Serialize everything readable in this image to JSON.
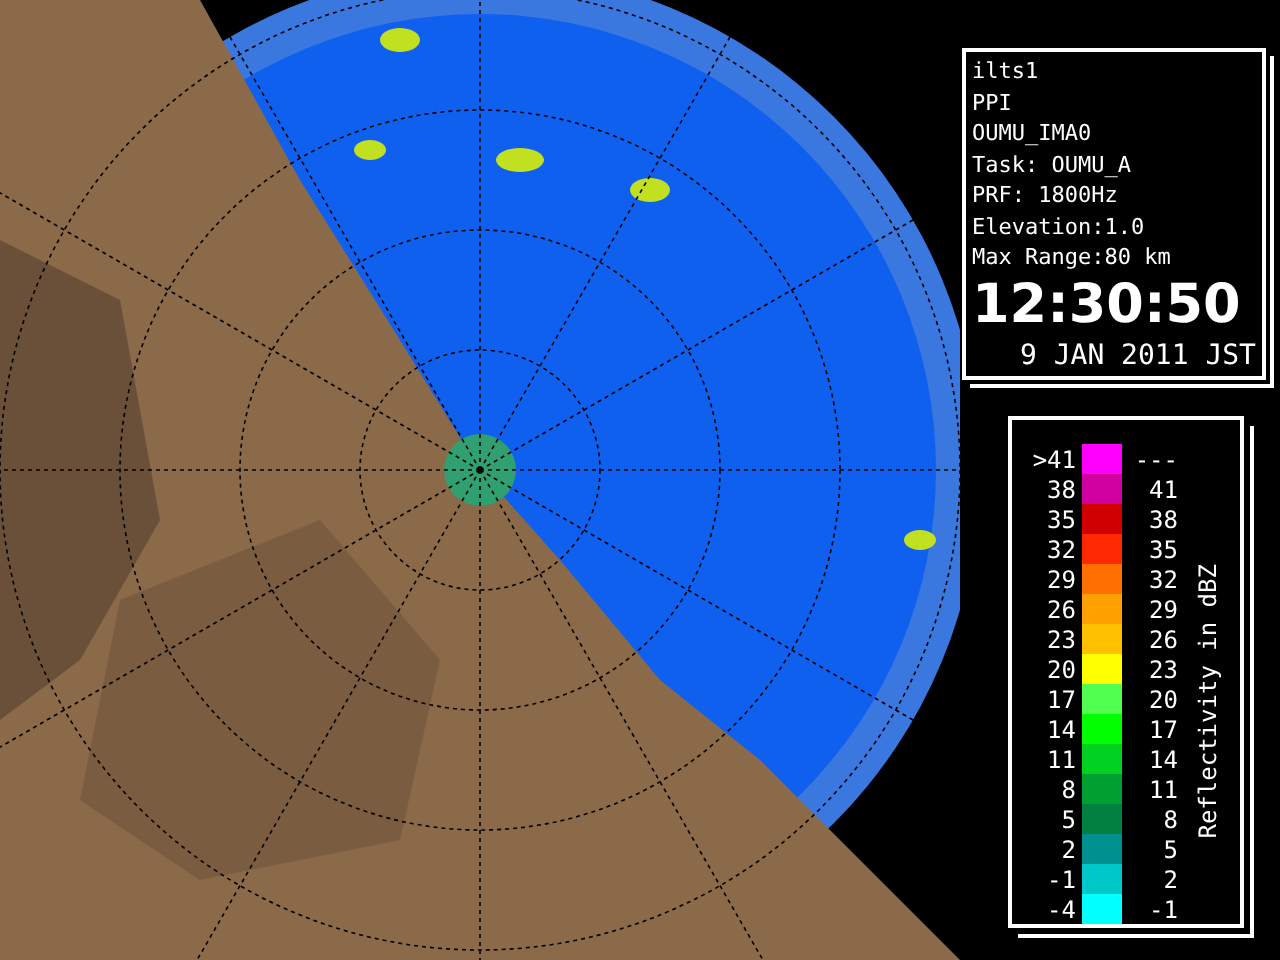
{
  "info": {
    "lines": [
      "ilts1",
      "PPI",
      "OUMU_IMA0",
      "Task: OUMU_A",
      "PRF: 1800Hz",
      "Elevation:1.0",
      "Max Range:80 km"
    ],
    "time": "12:30:50",
    "date": "9 JAN 2011 JST"
  },
  "legend": {
    "title": "Reflectivity in dBZ",
    "rows": [
      {
        "low": ">41",
        "high": "---",
        "color": "#ff00ff"
      },
      {
        "low": "38",
        "high": "41",
        "color": "#d000a0"
      },
      {
        "low": "35",
        "high": "38",
        "color": "#d00000"
      },
      {
        "low": "32",
        "high": "35",
        "color": "#ff2800"
      },
      {
        "low": "29",
        "high": "32",
        "color": "#ff7000"
      },
      {
        "low": "26",
        "high": "29",
        "color": "#ffa000"
      },
      {
        "low": "23",
        "high": "26",
        "color": "#ffc000"
      },
      {
        "low": "20",
        "high": "23",
        "color": "#ffff00"
      },
      {
        "low": "17",
        "high": "20",
        "color": "#50ff50"
      },
      {
        "low": "14",
        "high": "17",
        "color": "#00ff00"
      },
      {
        "low": "11",
        "high": "14",
        "color": "#00d020"
      },
      {
        "low": "8",
        "high": "11",
        "color": "#00a030"
      },
      {
        "low": "5",
        "high": "8",
        "color": "#008040"
      },
      {
        "low": "2",
        "high": "5",
        "color": "#009090"
      },
      {
        "low": "-1",
        "high": "2",
        "color": "#00c8c8"
      },
      {
        "low": "-4",
        "high": "-1",
        "color": "#00ffff"
      }
    ]
  }
}
